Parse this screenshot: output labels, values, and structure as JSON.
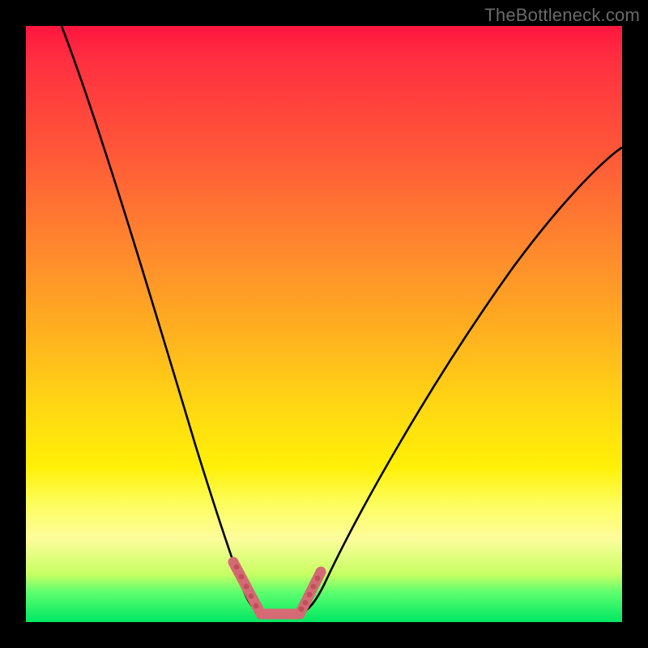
{
  "watermark": "TheBottleneck.com",
  "chart_data": {
    "type": "line",
    "title": "",
    "xlabel": "",
    "ylabel": "",
    "xlim": [
      0,
      100
    ],
    "ylim": [
      0,
      100
    ],
    "series": [
      {
        "name": "bottleneck-curve",
        "x": [
          6,
          10,
          14,
          18,
          22,
          26,
          30,
          32,
          34,
          36,
          38,
          40,
          42,
          44,
          46,
          50,
          56,
          62,
          70,
          80,
          90,
          100
        ],
        "y": [
          100,
          88,
          76,
          64,
          52,
          40,
          28,
          22,
          15,
          9,
          5,
          3,
          2,
          2,
          3,
          6,
          12,
          20,
          32,
          48,
          62,
          72
        ]
      }
    ],
    "annotations": [
      {
        "name": "optimal-region-marker",
        "x_range": [
          34,
          46
        ],
        "y_max": 9
      }
    ],
    "colors": {
      "curve": "#000000",
      "marker": "#d46b74",
      "gradient_top": "#ff163f",
      "gradient_bottom": "#00e763"
    }
  }
}
